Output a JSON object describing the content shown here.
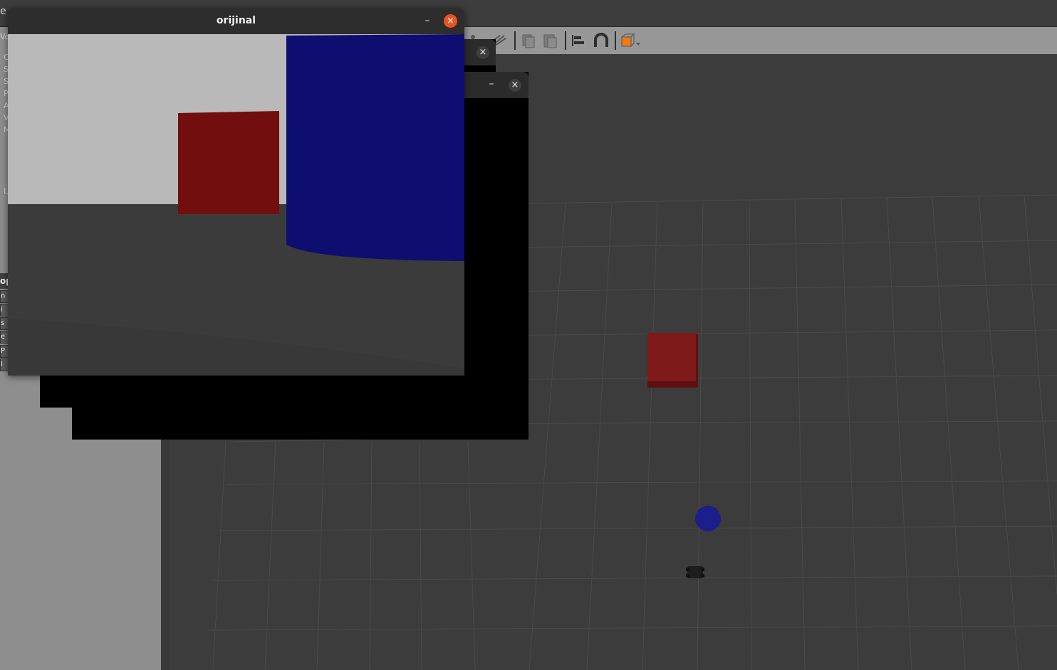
{
  "background_app": {
    "menu_fragment": "e",
    "toolbar_icons": [
      "translate-icon",
      "scale-icon",
      "copy-icon",
      "paste-icon",
      "align-icon",
      "snap-icon",
      "view-angle-icon"
    ],
    "left_panel": {
      "clipped_header": "Vo",
      "clipped_letters": [
        "C",
        "S",
        "S",
        "P",
        "A",
        "V",
        "M",
        "L"
      ],
      "property_section": "op",
      "property_letters": [
        "n",
        "i",
        "s",
        "e",
        "P",
        "I"
      ]
    },
    "viewport": {
      "objects": [
        {
          "name": "red-box",
          "color": "#7e1a1a"
        },
        {
          "name": "blue-cylinder",
          "color": "#1c1f8a"
        },
        {
          "name": "robot",
          "color": "#202020"
        }
      ]
    }
  },
  "windows": {
    "front": {
      "title": "orijinal",
      "minimize_label": "–",
      "close_label": "×",
      "scene": {
        "sky_color": "#b9b9b9",
        "ground_color": "#3b3b3b",
        "box_color": "#730e0f",
        "cylinder_color": "#0e0e70"
      }
    },
    "back1": {
      "close_label": "×"
    },
    "back2": {
      "minimize_label": "–",
      "close_label": "×"
    }
  }
}
